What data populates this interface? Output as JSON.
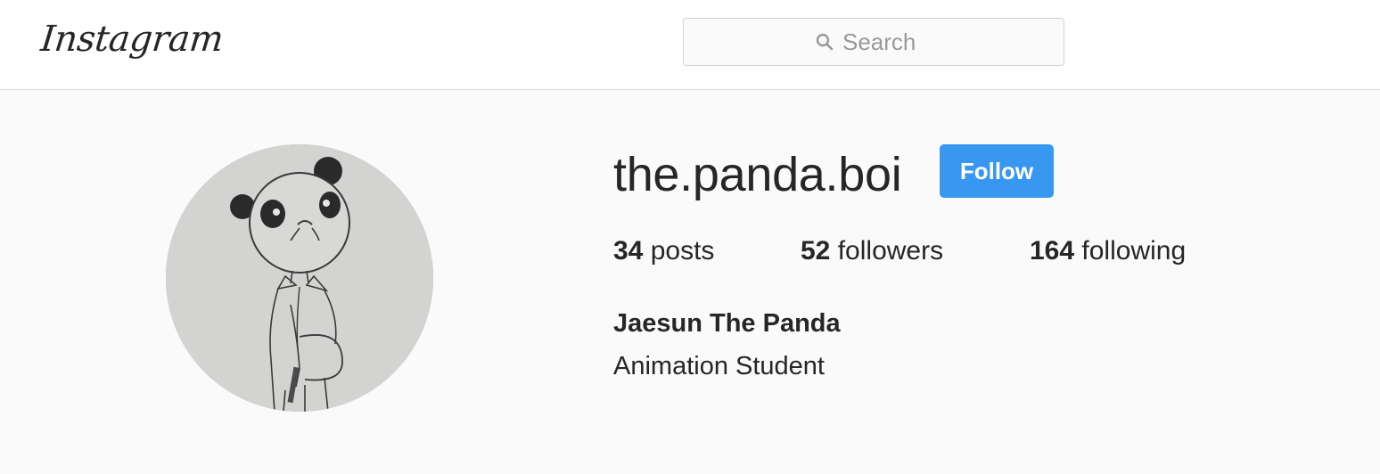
{
  "header": {
    "logo_text": "Instagram",
    "search": {
      "placeholder": "Search",
      "icon": "search-icon"
    }
  },
  "profile": {
    "avatar_icon": "panda-drawing",
    "username": "the.panda.boi",
    "follow_label": "Follow",
    "stats": {
      "posts_count": "34",
      "posts_label": "posts",
      "followers_count": "52",
      "followers_label": "followers",
      "following_count": "164",
      "following_label": "following"
    },
    "full_name": "Jaesun The Panda",
    "bio": "Animation Student"
  },
  "colors": {
    "accent": "#3897f0",
    "text": "#262626",
    "muted": "#999999",
    "background": "#fafafa",
    "border": "#dbdbdb"
  }
}
